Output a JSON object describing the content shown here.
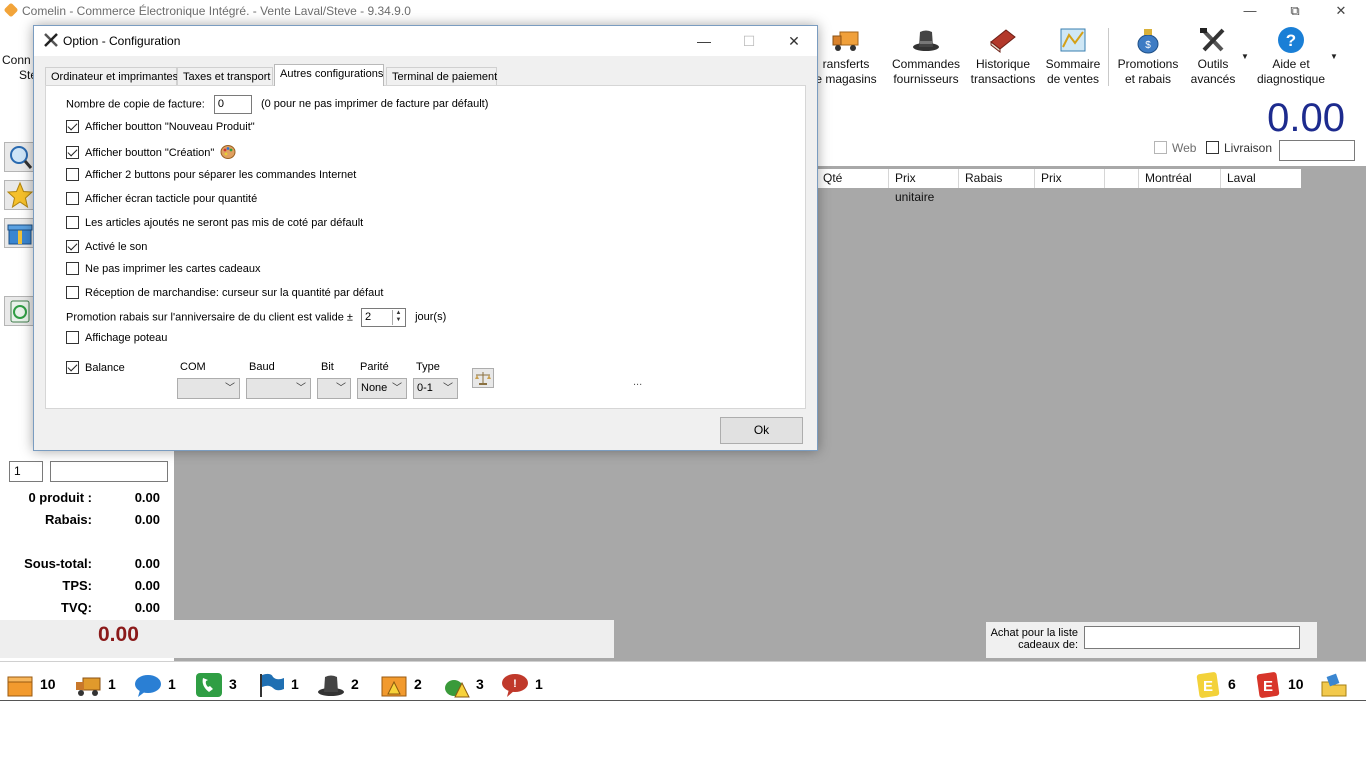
{
  "window": {
    "title": "Comelin - Commerce Électronique Intégré. - Vente Laval/Steve - 9.34.9.0",
    "minimize": "—",
    "restore": "⧉",
    "close": "✕"
  },
  "toolbar": {
    "left_partial_1": "Conn",
    "left_partial_2": "Ste",
    "items": [
      {
        "line1": "ransferts",
        "line2": "e magasins",
        "icon": "truck-icon"
      },
      {
        "line1": "Commandes",
        "line2": "fournisseurs",
        "icon": "top-hat-icon"
      },
      {
        "line1": "Historique",
        "line2": "transactions",
        "icon": "book-icon"
      },
      {
        "line1": "Sommaire",
        "line2": "de ventes",
        "icon": "chart-icon"
      },
      {
        "line1": "Promotions",
        "line2": "et rabais",
        "icon": "money-bag-icon"
      },
      {
        "line1": "Outils",
        "line2": "avancés",
        "icon": "tools-icon"
      },
      {
        "line1": "Aide et",
        "line2": "diagnostique",
        "icon": "help-icon"
      }
    ]
  },
  "summary": {
    "big_total": "0.00",
    "web_label": "Web",
    "delivery_label": "Livraison"
  },
  "grid": {
    "columns": [
      "Qté",
      "Prix unitaire",
      "Rabais",
      "Prix",
      "",
      "Montréal",
      "Laval"
    ]
  },
  "totals": {
    "qty_value": "1",
    "products_label": "0 produit :",
    "products_value": "0.00",
    "discount_label": "Rabais:",
    "discount_value": "0.00",
    "subtotal_label": "Sous-total:",
    "subtotal_value": "0.00",
    "tps_label": "TPS:",
    "tps_value": "0.00",
    "tvq_label": "TVQ:",
    "tvq_value": "0.00",
    "grand_total": "0.00"
  },
  "gift": {
    "label": "Achat pour la liste cadeaux de:"
  },
  "statusbar": {
    "items": [
      {
        "icon": "box-icon",
        "count": "10",
        "color": "#f29a2e"
      },
      {
        "icon": "truck-icon",
        "count": "1",
        "color": "#e09a2c"
      },
      {
        "icon": "chat-bubble-icon",
        "count": "1",
        "color": "#2a7fd4"
      },
      {
        "icon": "phone-icon",
        "count": "3",
        "color": "#2f9e44"
      },
      {
        "icon": "flag-icon",
        "count": "1",
        "color": "#1f6fb2"
      },
      {
        "icon": "top-hat-icon",
        "count": "2",
        "color": "#333333"
      },
      {
        "icon": "box-warning-icon",
        "count": "2",
        "color": "#f29a2e"
      },
      {
        "icon": "money-warning-icon",
        "count": "3",
        "color": "#3a9a3a"
      },
      {
        "icon": "alert-bubble-icon",
        "count": "1",
        "color": "#c0392b"
      }
    ],
    "right_items": [
      {
        "icon": "e-yellow-icon",
        "count": "6",
        "color": "#f3d23a"
      },
      {
        "icon": "e-red-icon",
        "count": "10",
        "color": "#d8352a"
      }
    ]
  },
  "dialog": {
    "title": "Option - Configuration",
    "tabs": [
      "Ordinateur et imprimantes",
      "Taxes et transport",
      "Autres configurations",
      "Terminal de paiement"
    ],
    "active_tab": 2,
    "invoice_copies_label": "Nombre de copie de facture:",
    "invoice_copies_value": "0",
    "invoice_copies_hint": "(0 pour ne pas imprimer de facture par défault)",
    "options": [
      {
        "label": "Afficher boutton \"Nouveau Produit\"",
        "checked": true
      },
      {
        "label": "Afficher boutton \"Création\"",
        "checked": true
      },
      {
        "label": "Afficher 2 buttons pour séparer les commandes Internet",
        "checked": false
      },
      {
        "label": "Afficher écran tacticle pour quantité",
        "checked": false
      },
      {
        "label": "Les articles ajoutés ne seront pas mis de coté par défault",
        "checked": false
      },
      {
        "label": "Activé le son",
        "checked": true
      },
      {
        "label": "Ne pas imprimer les cartes cadeaux",
        "checked": false
      },
      {
        "label": "Réception de marchandise: curseur sur la quantité par défaut",
        "checked": false
      }
    ],
    "birthday_label": "Promotion rabais sur l'anniversaire de du client est valide ±",
    "birthday_value": "2",
    "birthday_unit": "jour(s)",
    "pole_display_label": "Affichage poteau",
    "pole_display_checked": false,
    "scale_label": "Balance",
    "scale_checked": true,
    "com_label": "COM",
    "baud_label": "Baud",
    "bit_label": "Bit",
    "parity_label": "Parité",
    "parity_value": "None",
    "type_label": "Type",
    "type_value": "0-1",
    "ellipsis": "...",
    "ok": "Ok"
  }
}
